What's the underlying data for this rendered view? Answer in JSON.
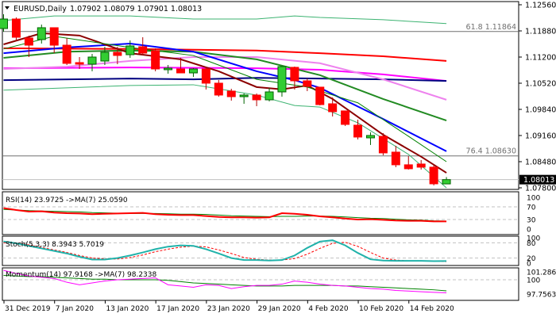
{
  "header": {
    "symbol": "EURUSD,Daily",
    "ohlc": "1.07902 1.08079 1.07901 1.08013"
  },
  "colors": {
    "bull": "#32cd32",
    "bear": "#ff0000",
    "border": "#000000",
    "fib": "#707070"
  },
  "chart_data": {
    "type": "candlestick",
    "title": "EURUSD,Daily",
    "price_axis": {
      "range": [
        1.078,
        1.1256
      ],
      "ticks": [
        "1.12560",
        "1.11880",
        "1.11200",
        "1.10520",
        "1.09840",
        "1.09160",
        "1.08480",
        "1.07800"
      ],
      "last_price": "1.08013"
    },
    "date_ticks": [
      {
        "bar": 0,
        "label": "31 Dec 2019"
      },
      {
        "bar": 4,
        "label": "7 Jan 2020"
      },
      {
        "bar": 8,
        "label": "13 Jan 2020"
      },
      {
        "bar": 12,
        "label": "17 Jan 2020"
      },
      {
        "bar": 16,
        "label": "23 Jan 2020"
      },
      {
        "bar": 20,
        "label": "29 Jan 2020"
      },
      {
        "bar": 24,
        "label": "4 Feb 2020"
      },
      {
        "bar": 28,
        "label": "10 Feb 2020"
      },
      {
        "bar": 32,
        "label": "14 Feb 2020"
      }
    ],
    "fib_levels": [
      {
        "label": "61.8 1.11864",
        "price": 1.11864
      },
      {
        "label": "76.4 1.08630",
        "price": 1.0863
      }
    ],
    "candles": [
      [
        1.11942,
        1.12313,
        1.1186,
        1.12189
      ],
      [
        1.12189,
        1.1223,
        1.11612,
        1.11715
      ],
      [
        1.11695,
        1.11757,
        1.112,
        1.11509
      ],
      [
        1.11654,
        1.12045,
        1.11551,
        1.11963
      ],
      [
        1.11963,
        1.11963,
        1.11303,
        1.11509
      ],
      [
        1.11509,
        1.11695,
        1.10994,
        1.11036
      ],
      [
        1.11056,
        1.112,
        1.10891,
        1.11015
      ],
      [
        1.11015,
        1.11283,
        1.1083,
        1.112
      ],
      [
        1.11097,
        1.11468,
        1.10994,
        1.11324
      ],
      [
        1.11324,
        1.11468,
        1.11015,
        1.11242
      ],
      [
        1.11262,
        1.11633,
        1.1118,
        1.11489
      ],
      [
        1.11468,
        1.11715,
        1.11242,
        1.11303
      ],
      [
        1.11365,
        1.11427,
        1.1083,
        1.10891
      ],
      [
        1.10871,
        1.10994,
        1.10768,
        1.10912
      ],
      [
        1.10891,
        1.1118,
        1.10788,
        1.10788
      ],
      [
        1.10788,
        1.10912,
        1.10685,
        1.10891
      ],
      [
        1.10891,
        1.10953,
        1.10356,
        1.10521
      ],
      [
        1.10521,
        1.10603,
        1.1017,
        1.10212
      ],
      [
        1.10315,
        1.10376,
        1.10067,
        1.1017
      ],
      [
        1.1017,
        1.10253,
        1.09985,
        1.10212
      ],
      [
        1.10212,
        1.10253,
        1.09923,
        1.10088
      ],
      [
        1.10088,
        1.10397,
        1.10047,
        1.10294
      ],
      [
        1.10294,
        1.10953,
        1.1017,
        1.10953
      ],
      [
        1.10933,
        1.10953,
        1.10356,
        1.10582
      ],
      [
        1.10582,
        1.10644,
        1.10315,
        1.10438
      ],
      [
        1.10418,
        1.10418,
        1.09944,
        1.09964
      ],
      [
        1.09985,
        1.1015,
        1.09655,
        1.09779
      ],
      [
        1.098,
        1.098,
        1.09408,
        1.09449
      ],
      [
        1.09429,
        1.09573,
        1.09058,
        1.0912
      ],
      [
        1.09099,
        1.09243,
        1.08914,
        1.09161
      ],
      [
        1.0914,
        1.09223,
        1.08646,
        1.08708
      ],
      [
        1.08728,
        1.08893,
        1.08337,
        1.08399
      ],
      [
        1.08399,
        1.08625,
        1.08275,
        1.08296
      ],
      [
        1.08419,
        1.08522,
        1.08275,
        1.08337
      ],
      [
        1.08337,
        1.08399,
        1.07863,
        1.07904
      ],
      [
        1.07902,
        1.08079,
        1.07901,
        1.08013
      ]
    ],
    "overlays": [
      {
        "name": "ma-red",
        "color": "#ff0000",
        "width": 2,
        "points": [
          [
            0,
            1.1143
          ],
          [
            10,
            1.1141
          ],
          [
            20,
            1.1137
          ],
          [
            25,
            1.113
          ],
          [
            30,
            1.1122
          ],
          [
            35,
            1.111
          ]
        ]
      },
      {
        "name": "ma-magenta",
        "color": "#ff00ff",
        "width": 2,
        "points": [
          [
            0,
            1.1091
          ],
          [
            10,
            1.1093
          ],
          [
            20,
            1.1091
          ],
          [
            25,
            1.1087
          ],
          [
            30,
            1.1075
          ],
          [
            35,
            1.1058
          ]
        ]
      },
      {
        "name": "ma-navy",
        "color": "#000080",
        "width": 2,
        "points": [
          [
            0,
            1.106
          ],
          [
            10,
            1.1064
          ],
          [
            15,
            1.1062
          ],
          [
            20,
            1.1066
          ],
          [
            25,
            1.1064
          ],
          [
            30,
            1.1062
          ],
          [
            35,
            1.1058
          ]
        ]
      },
      {
        "name": "ma-violet",
        "color": "#ee82ee",
        "width": 2,
        "points": [
          [
            0,
            1.1089
          ],
          [
            5,
            1.1095
          ],
          [
            10,
            1.111
          ],
          [
            15,
            1.112
          ],
          [
            20,
            1.112
          ],
          [
            25,
            1.1104
          ],
          [
            30,
            1.1062
          ],
          [
            35,
            1.1009
          ]
        ]
      },
      {
        "name": "ma-darkgreen",
        "color": "#228b22",
        "width": 2,
        "points": [
          [
            0,
            1.1118
          ],
          [
            5,
            1.1134
          ],
          [
            10,
            1.1137
          ],
          [
            15,
            1.1134
          ],
          [
            20,
            1.1114
          ],
          [
            25,
            1.1073
          ],
          [
            30,
            1.1011
          ],
          [
            35,
            1.0955
          ]
        ]
      },
      {
        "name": "ma-blue",
        "color": "#0000ff",
        "width": 2,
        "points": [
          [
            0,
            1.113
          ],
          [
            5,
            1.1145
          ],
          [
            10,
            1.1155
          ],
          [
            15,
            1.1134
          ],
          [
            20,
            1.1083
          ],
          [
            23,
            1.106
          ],
          [
            25,
            1.104
          ],
          [
            30,
            1.0959
          ],
          [
            35,
            1.0875
          ]
        ]
      },
      {
        "name": "ma-darkred",
        "color": "#8b0000",
        "width": 2,
        "points": [
          [
            0,
            1.1153
          ],
          [
            3,
            1.1182
          ],
          [
            6,
            1.1176
          ],
          [
            10,
            1.113
          ],
          [
            14,
            1.1114
          ],
          [
            17,
            1.1083
          ],
          [
            20,
            1.1042
          ],
          [
            22,
            1.1036
          ],
          [
            24,
            1.1046
          ],
          [
            26,
            1.1011
          ],
          [
            30,
            1.0918
          ],
          [
            33,
            1.0861
          ],
          [
            35,
            1.0819
          ]
        ]
      },
      {
        "name": "ma-thin-green",
        "color": "#008000",
        "width": 1,
        "points": [
          [
            0,
            1.1141
          ],
          [
            4,
            1.1174
          ],
          [
            10,
            1.1145
          ],
          [
            15,
            1.1124
          ],
          [
            20,
            1.1062
          ],
          [
            24,
            1.1042
          ],
          [
            28,
            1.1001
          ],
          [
            32,
            1.0914
          ],
          [
            35,
            1.0848
          ]
        ]
      },
      {
        "name": "band-upper",
        "color": "#3cb371",
        "width": 1,
        "points": [
          [
            0,
            1.1215
          ],
          [
            4,
            1.1227
          ],
          [
            10,
            1.1227
          ],
          [
            15,
            1.1219
          ],
          [
            20,
            1.1219
          ],
          [
            23,
            1.1227
          ],
          [
            25,
            1.1223
          ],
          [
            30,
            1.1217
          ],
          [
            35,
            1.1207
          ]
        ]
      },
      {
        "name": "band-lower",
        "color": "#3cb371",
        "width": 1,
        "points": [
          [
            0,
            1.1034
          ],
          [
            10,
            1.1046
          ],
          [
            15,
            1.1048
          ],
          [
            20,
            1.1021
          ],
          [
            23,
            1.0994
          ],
          [
            25,
            1.099
          ],
          [
            28,
            1.0949
          ],
          [
            32,
            1.0867
          ],
          [
            35,
            1.078
          ]
        ]
      }
    ],
    "indicators": {
      "rsi": {
        "label": "RSI(14) 23.9725  ->MA(7) 25.0590",
        "levels": [
          "100",
          "70",
          "30",
          "0"
        ],
        "values": [
          66,
          60,
          55,
          56,
          52,
          50,
          49,
          47,
          48,
          49,
          50,
          51,
          47,
          45,
          44,
          44,
          41,
          38,
          37,
          37,
          36,
          37,
          50,
          48,
          45,
          40,
          37,
          33,
          30,
          31,
          29,
          27,
          26,
          26,
          24,
          23.97
        ],
        "ma": [
          62,
          60,
          58,
          57,
          56,
          55,
          54,
          52,
          51,
          50,
          49,
          49,
          49,
          48,
          47,
          47,
          46,
          44,
          42,
          41,
          40,
          39,
          40,
          40,
          41,
          41,
          40,
          38,
          36,
          34,
          33,
          31,
          29,
          28,
          26,
          25.06
        ]
      },
      "stoch": {
        "label": "Stoch(5,3,3) 8.3943 5.7019",
        "levels": [
          "100",
          "80",
          "20",
          "0"
        ],
        "main": [
          85,
          78,
          68,
          58,
          48,
          38,
          25,
          14,
          14,
          20,
          30,
          42,
          55,
          65,
          70,
          68,
          55,
          38,
          20,
          12,
          12,
          10,
          12,
          30,
          60,
          85,
          90,
          70,
          40,
          15,
          10,
          9,
          9,
          9,
          8,
          8.39
        ],
        "signal": [
          80,
          80,
          72,
          62,
          52,
          42,
          30,
          20,
          17,
          16,
          22,
          32,
          45,
          55,
          63,
          67,
          64,
          52,
          38,
          22,
          15,
          12,
          12,
          18,
          35,
          58,
          78,
          82,
          66,
          42,
          20,
          12,
          9,
          8,
          8,
          5.7
        ]
      },
      "momentum": {
        "label": "Momentum(14) 97.9168  ->MA(7) 98.2338",
        "levels": [
          "101.2865",
          "100",
          "97.7563"
        ],
        "values": [
          101.5,
          101.0,
          100.6,
          100.4,
          100.2,
          99.6,
          99.2,
          99.5,
          99.8,
          100.0,
          100.1,
          100.2,
          100.3,
          99.2,
          99.0,
          98.8,
          99.2,
          99.1,
          98.6,
          98.9,
          99.1,
          99.1,
          99.3,
          99.8,
          99.6,
          99.3,
          99.1,
          99.0,
          98.8,
          98.6,
          98.5,
          98.3,
          98.2,
          98.1,
          98.0,
          97.92
        ],
        "ma": [
          100.7,
          100.6,
          100.5,
          100.5,
          100.4,
          100.3,
          100.2,
          100.1,
          100.1,
          100.0,
          100.0,
          100.0,
          100.0,
          99.9,
          99.7,
          99.5,
          99.4,
          99.3,
          99.2,
          99.1,
          99.0,
          99.0,
          99.0,
          99.1,
          99.1,
          99.1,
          99.1,
          99.0,
          99.0,
          98.9,
          98.8,
          98.7,
          98.6,
          98.5,
          98.4,
          98.23
        ]
      }
    }
  }
}
